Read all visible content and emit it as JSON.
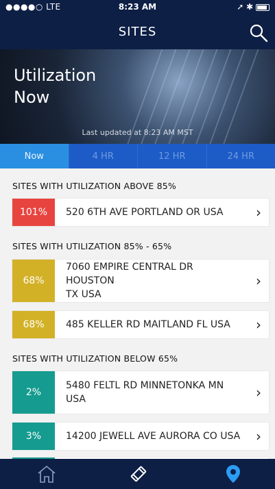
{
  "status": {
    "carrier": "●●●●○ LTE",
    "time": "8:23 AM"
  },
  "header": {
    "title": "SITES"
  },
  "hero": {
    "title_line1": "Utilization",
    "title_line2": "Now",
    "updated": "Last updated at 8:23 AM MST"
  },
  "tabs": [
    {
      "label": "Now"
    },
    {
      "label": "4 HR"
    },
    {
      "label": "12 HR"
    },
    {
      "label": "24 HR"
    }
  ],
  "sections": [
    {
      "title": "SITES WITH UTILIZATION ABOVE 85%",
      "items": [
        {
          "pct": "101%",
          "color": "#e8443f",
          "address": "520 6TH AVE PORTLAND OR USA"
        }
      ]
    },
    {
      "title": "SITES WITH UTILIZATION 85% - 65%",
      "items": [
        {
          "pct": "68%",
          "color": "#d3b127",
          "address_line1": "7060 EMPIRE CENTRAL DR HOUSTON",
          "address_line2": "TX USA"
        },
        {
          "pct": "68%",
          "color": "#d3b127",
          "address": "485 KELLER RD MAITLAND FL USA"
        }
      ]
    },
    {
      "title": "SITES WITH UTILIZATION BELOW 65%",
      "items": [
        {
          "pct": "2%",
          "color": "#159b8f",
          "address_line1": "5480 FELTL RD MINNETONKA MN",
          "address_line2": "USA"
        },
        {
          "pct": "3%",
          "color": "#159b8f",
          "address": "14200 JEWELL AVE AURORA CO USA"
        }
      ]
    }
  ],
  "bottom_nav": [
    {
      "icon": "home-icon"
    },
    {
      "icon": "satellite-icon"
    },
    {
      "icon": "location-pin-icon"
    }
  ],
  "colors": {
    "navy": "#0d1f45",
    "tab_active": "#2a8fe0",
    "tab": "#1d5cc7",
    "accent": "#2a9df4"
  }
}
